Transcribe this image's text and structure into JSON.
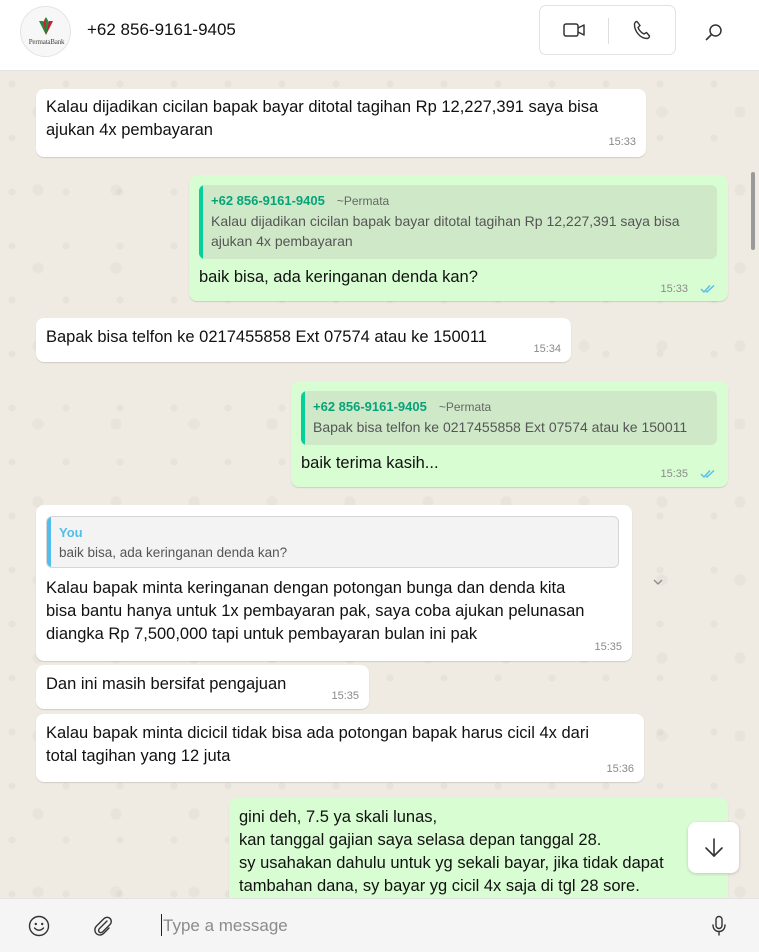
{
  "header": {
    "avatar_logo_text": "PermataBank",
    "contact_name": "+62 856-9161-9405",
    "icons": {
      "video": "video-camera-icon",
      "call": "phone-icon",
      "search": "search-icon"
    }
  },
  "colors": {
    "incoming_bubble": "#ffffff",
    "outgoing_bubble": "#d9fdd3",
    "quote_bar_green": "#06cf9c",
    "quote_bar_blue": "#53bdeb",
    "read_ticks": "#53bdeb",
    "chat_background": "#efeae2"
  },
  "messages": [
    {
      "direction": "in",
      "text": "Kalau dijadikan cicilan bapak bayar ditotal tagihan Rp 12,227,391 saya bisa\najukan 4x pembayaran",
      "time": "15:33"
    },
    {
      "direction": "out",
      "quote": {
        "name": "+62 856-9161-9405",
        "sub": "~Permata",
        "text": "Kalau dijadikan cicilan bapak bayar ditotal tagihan Rp 12,227,391 saya bisa\najukan 4x pembayaran"
      },
      "text": "baik bisa, ada keringanan denda kan?",
      "time": "15:33",
      "status": "read"
    },
    {
      "direction": "in",
      "text": "Bapak bisa telfon ke 0217455858 Ext 07574 atau ke 150011",
      "time": "15:34"
    },
    {
      "direction": "out",
      "quote": {
        "name": "+62 856-9161-9405",
        "sub": "~Permata",
        "text": "Bapak bisa telfon ke 0217455858 Ext 07574 atau ke 150011"
      },
      "text": "baik terima kasih...",
      "time": "15:35",
      "status": "read"
    },
    {
      "direction": "in",
      "quote": {
        "name": "You",
        "text": "baik bisa, ada keringanan denda kan?"
      },
      "text": "Kalau bapak minta keringanan dengan potongan bunga dan denda kita\nbisa bantu hanya untuk 1x pembayaran pak, saya coba ajukan pelunasan\ndiangka Rp 7,500,000 tapi untuk pembayaran bulan ini pak",
      "time": "15:35"
    },
    {
      "direction": "in",
      "text": "Dan ini masih bersifat pengajuan",
      "time": "15:35"
    },
    {
      "direction": "in",
      "text": "Kalau bapak minta dicicil tidak bisa ada potongan bapak harus cicil 4x dari\ntotal tagihan yang 12 juta",
      "time": "15:36"
    },
    {
      "direction": "out",
      "text": "gini deh, 7.5 ya skali lunas,\nkan tanggal gajian saya selasa depan tanggal 28.\nsy usahakan dahulu untuk yg sekali bayar, jika tidak dapat\ntambahan dana, sy bayar yg cicil 4x saja di tgl 28 sore."
    }
  ],
  "composer": {
    "placeholder": "Type a message",
    "icons": {
      "emoji": "emoji-icon",
      "attach": "paperclip-icon",
      "mic": "microphone-icon"
    }
  }
}
